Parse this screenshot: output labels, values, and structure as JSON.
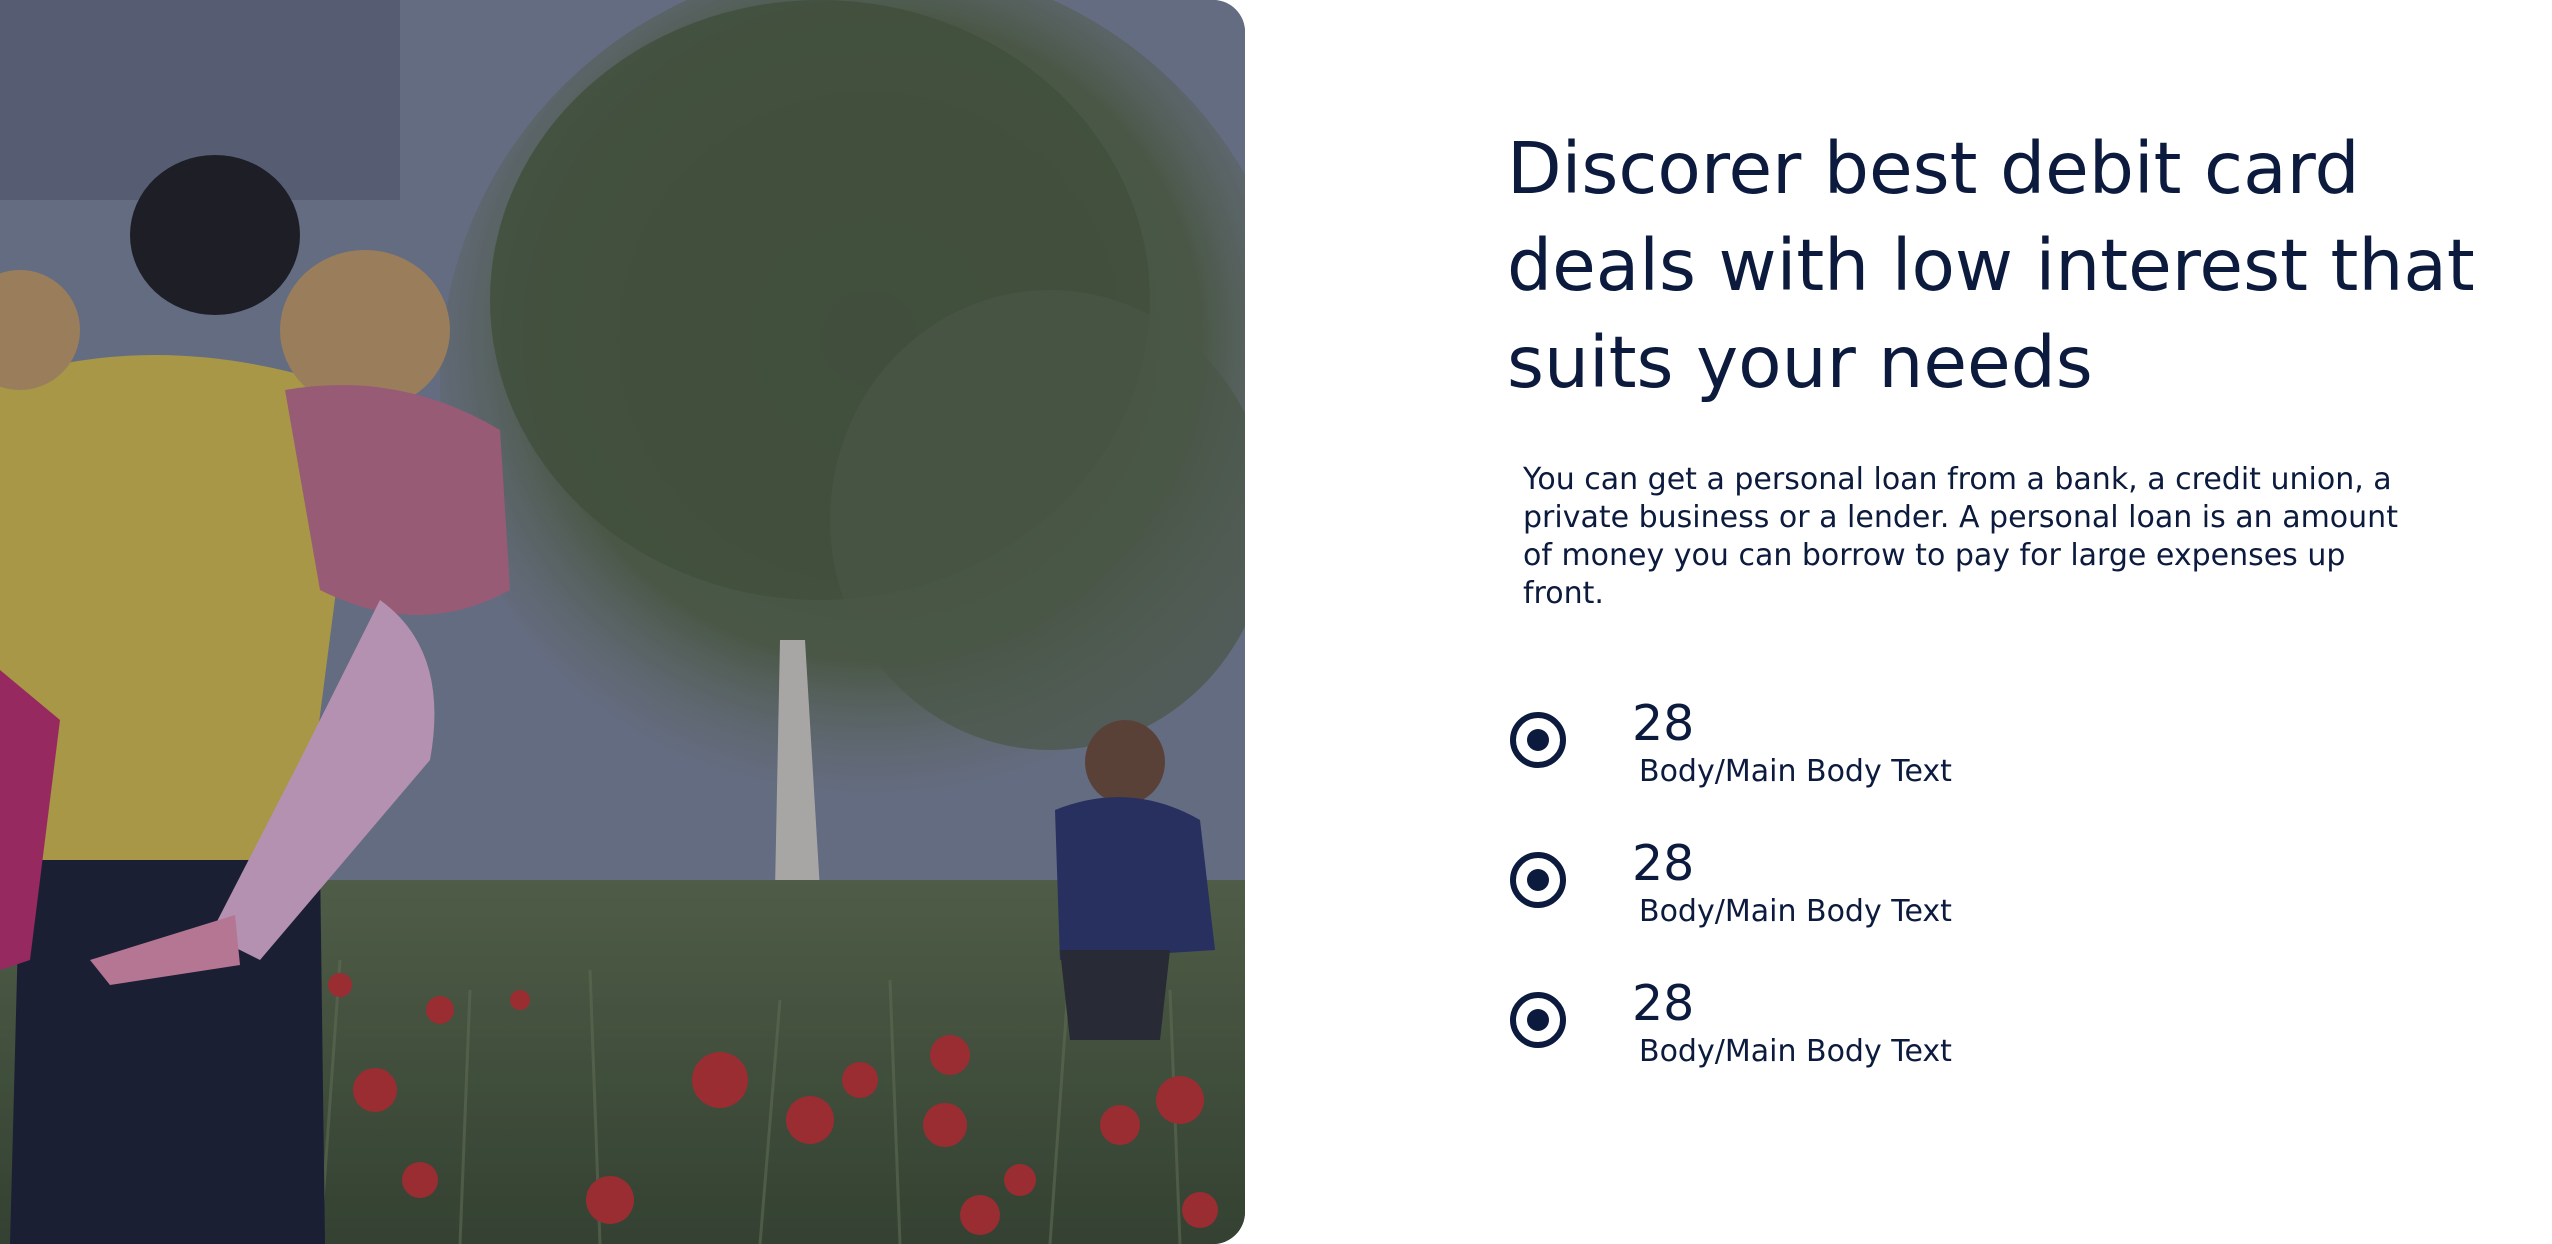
{
  "hero": {
    "image_alt": "Family walking through a field of red poppies",
    "headline_lines": [
      "Discorer best debit card",
      "deals with low interest that",
      "suits your needs"
    ],
    "description": "You can get a personal loan from a bank, a credit union, a private business or a lender. A personal loan is an amount of money you can borrow to pay for large expenses up front."
  },
  "features": [
    {
      "value": "28",
      "label": "Body/Main Body Text",
      "icon": "radio-selected-icon"
    },
    {
      "value": "28",
      "label": "Body/Main Body Text",
      "icon": "radio-selected-icon"
    },
    {
      "value": "28",
      "label": "Body/Main Body Text",
      "icon": "radio-selected-icon"
    }
  ],
  "colors": {
    "text": "#0b1a3d",
    "background": "#ffffff"
  }
}
